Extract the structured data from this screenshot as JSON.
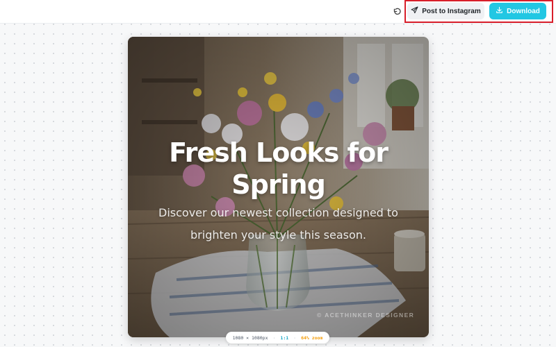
{
  "toolbar": {
    "undo_icon": "rotate-left-icon",
    "post_label": "Post to Instagram",
    "post_icon": "send-icon",
    "download_label": "Download",
    "download_icon": "download-icon",
    "accent": "#22c7e3",
    "highlight_color": "#d81e2a"
  },
  "canvas": {
    "headline": "Fresh Looks for Spring",
    "subheadline": "Discover our newest collection designed to brighten your style this season.",
    "watermark": "© ACETHINKER DESIGNER",
    "image_description": "vase-of-wildflowers-on-wooden-table"
  },
  "info": {
    "dimensions": "1080 × 1080px",
    "ratio": "1:1",
    "zoom": "64% zoom"
  }
}
